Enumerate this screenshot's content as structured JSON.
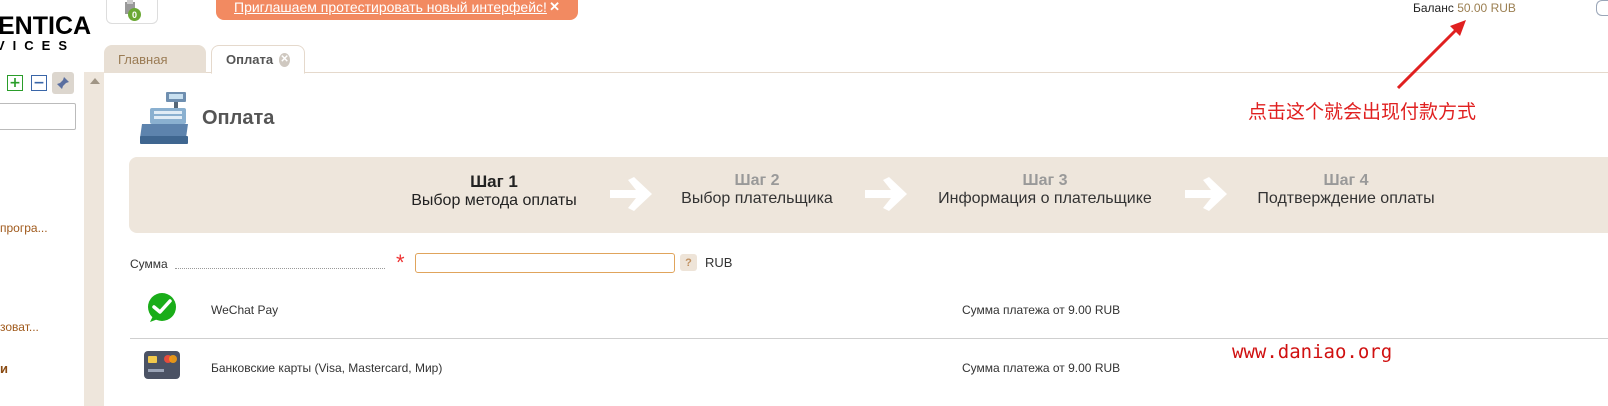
{
  "logo": {
    "main": "ENTICA",
    "sub": "VICES"
  },
  "header": {
    "notification_count": "0",
    "banner_text": "Приглашаем протестировать новый интерфейс!",
    "balance_label": "Баланс",
    "balance_value": "50.00 RUB"
  },
  "sidebar": {
    "items": [
      {
        "label": "програ..."
      },
      {
        "label": "зоват..."
      },
      {
        "label": "и"
      }
    ]
  },
  "tabs": [
    {
      "label": "Главная",
      "active": false
    },
    {
      "label": "Оплата",
      "active": true
    }
  ],
  "page": {
    "title": "Оплата"
  },
  "steps": [
    {
      "num": "Шаг 1",
      "name": "Выбор метода оплаты",
      "active": true
    },
    {
      "num": "Шаг 2",
      "name": "Выбор плательщика",
      "active": false
    },
    {
      "num": "Шаг 3",
      "name": "Информация о плательщике",
      "active": false
    },
    {
      "num": "Шаг 4",
      "name": "Подтверждение оплаты",
      "active": false
    }
  ],
  "form": {
    "sum_label": "Сумма",
    "required_mark": "*",
    "sum_value": "",
    "help": "?",
    "currency": "RUB"
  },
  "payment_methods": [
    {
      "name": "WeChat Pay",
      "min": "Сумма платежа от 9.00 RUB",
      "icon": "wechat-icon"
    },
    {
      "name": "Банковские карты (Visa, Mastercard, Мир)",
      "min": "Сумма платежа от 9.00 RUB",
      "icon": "bank-card-icon"
    }
  ],
  "annotation": {
    "note": "点击这个就会出现付款方式",
    "watermark": "www.daniao.org"
  },
  "colors": {
    "banner": "#f28a61",
    "steps_bg": "#eee6dc",
    "annotation_red": "#e02020",
    "wechat_green": "#1aad19"
  }
}
